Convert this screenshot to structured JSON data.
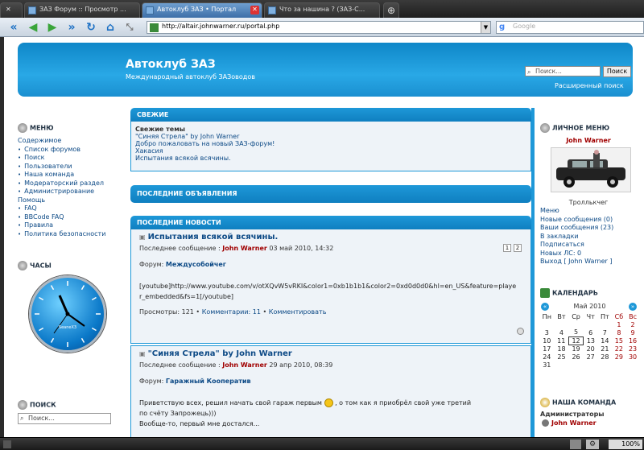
{
  "browser": {
    "tabs": [
      {
        "label": "ЗАЗ Форум :: Просмотр ..."
      },
      {
        "label": "Автоклуб ЗАЗ • Портал"
      },
      {
        "label": "Что за нашина ? (ЗАЗ-С..."
      }
    ],
    "url": "http://altair.johnwarner.ru/portal.php",
    "search_placeholder": "Google",
    "zoom": "100%"
  },
  "header": {
    "title": "Автоклуб ЗАЗ",
    "subtitle": "Международный автоклуб ЗАЗоводов",
    "search_placeholder": "Поиск...",
    "search_button": "Поиск",
    "advanced_search": "Расширенный поиск"
  },
  "left": {
    "menu_title": "МЕНЮ",
    "menu_items": [
      "Содержимое",
      "Список форумов",
      "Поиск",
      "Пользователи",
      "Наша команда",
      "Модераторский раздел",
      "Администрирование",
      "Помощь",
      "FAQ",
      "BBCode FAQ",
      "Правила",
      "Политика безопасности"
    ],
    "clock_title": "ЧАСЫ",
    "clock_brand": "SeaneX3",
    "search_title": "ПОИСК",
    "search_placeholder": "Поиск..."
  },
  "center": {
    "fresh": {
      "title": "СВЕЖИЕ",
      "subtitle": "Свежие темы",
      "items": [
        "\"Синяя Стрела\" by John Warner",
        "Добро пожаловать на новый ЗАЗ-форум!",
        "Хакасия",
        "Испытания всякой всячины."
      ]
    },
    "ads_title": "ПОСЛЕДНИЕ ОБЪЯВЛЕНИЯ",
    "news_title": "ПОСЛЕДНИЕ НОВОСТИ",
    "posts": [
      {
        "title": "Испытания всякой всячины.",
        "meta_prefix": "Последнее сообщение :",
        "author": "John Warner",
        "date": "03 май 2010, 14:32",
        "forum_prefix": "Форум:",
        "forum": "Междусобойчег",
        "body": "[youtube]http://www.youtube.com/v/otXQvW5vRKI&color1=0xb1b1b1&color2=0xd0d0d0&hl=en_US&feature=player_embedded&fs=1[/youtube]",
        "views": "Просмотры: 121",
        "comments": "Комментарии: 11",
        "comment_link": "Комментировать",
        "pages": [
          "1",
          "2"
        ]
      },
      {
        "title": "\"Синяя Стрела\" by John Warner",
        "meta_prefix": "Последнее сообщение :",
        "author": "John Warner",
        "date": "29 апр 2010, 08:39",
        "forum_prefix": "Форум:",
        "forum": "Гаражный Кооператив",
        "body1": "Приветствую всех, решил начать свой гараж первым",
        "body2": ", о том как я приобрёл свой уже третий",
        "body3": "по счёту Запрожець)))",
        "body4": "Вообще-то, первый мне достался..."
      }
    ]
  },
  "right": {
    "personal_title": "ЛИЧНОЕ МЕНЮ",
    "username": "John Warner",
    "rank": "Троллькчег",
    "menu_items": [
      "Меню",
      "Новые сообщения (0)",
      "Ваши сообщения (23)",
      "В закладки",
      "Подписаться",
      "Новых ЛС: 0",
      "Выход [ John Warner ]"
    ],
    "calendar_title": "КАЛЕНДАРЬ",
    "calendar_month": "Май 2010",
    "weekdays": [
      "Пн",
      "Вт",
      "Ср",
      "Чт",
      "Пт",
      "Сб",
      "Вс"
    ],
    "weeks": [
      [
        "",
        "",
        "",
        "",
        "",
        "1",
        "2"
      ],
      [
        "3",
        "4",
        "5",
        "6",
        "7",
        "8",
        "9"
      ],
      [
        "10",
        "11",
        "12",
        "13",
        "14",
        "15",
        "16"
      ],
      [
        "17",
        "18",
        "19",
        "20",
        "21",
        "22",
        "23"
      ],
      [
        "24",
        "25",
        "26",
        "27",
        "28",
        "29",
        "30"
      ],
      [
        "31",
        "",
        "",
        "",
        "",
        "",
        ""
      ]
    ],
    "today": "12",
    "team_title": "НАША КОМАНДА",
    "team_group": "Администраторы",
    "team_member": "John Warner"
  }
}
